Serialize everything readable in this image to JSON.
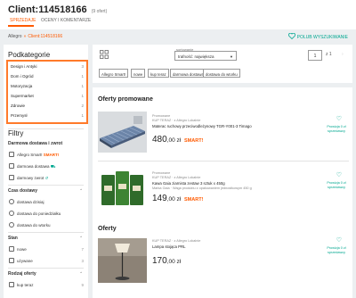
{
  "header": {
    "title": "Client:114518166",
    "offer_count": "(9 ofert)",
    "tabs": [
      "SPRZEDAJE",
      "OCENY I KOMENTARZE"
    ]
  },
  "breadcrumb": {
    "root": "Allegro",
    "separator": "»",
    "current": "Client:114518166"
  },
  "follow": {
    "label": "POLUB WYSZUKIWANIE"
  },
  "sidebar": {
    "subcategories_title": "Podkategorie",
    "categories": [
      {
        "label": "Design i Antyki",
        "count": "3"
      },
      {
        "label": "Dom i Ogród",
        "count": "1"
      },
      {
        "label": "Motoryzacja",
        "count": "1"
      },
      {
        "label": "Supermarket",
        "count": "1"
      },
      {
        "label": "Zdrowie",
        "count": "2"
      },
      {
        "label": "Przemysł",
        "count": "1"
      }
    ],
    "filters_title": "Filtry",
    "delivery": {
      "title": "Darmowa dostawa i zwrot",
      "options": [
        {
          "label": "Allegro Smart!",
          "badge": "SMART!"
        },
        {
          "label": "darmowa dostawa"
        },
        {
          "label": "darmowy zwrot"
        }
      ]
    },
    "time": {
      "title": "Czas dostawy",
      "options": [
        "dostawa dzisiaj",
        "dostawa do poniedziałku",
        "dostawa do wtorku"
      ]
    },
    "condition": {
      "title": "Stan",
      "options": [
        {
          "label": "nowe",
          "count": "7"
        },
        {
          "label": "używane",
          "count": "3"
        }
      ]
    },
    "offer_type": {
      "title": "Rodzaj oferty",
      "options": [
        {
          "label": "kup teraz",
          "count": "9"
        }
      ]
    }
  },
  "toolbar": {
    "sort_label": "sortowanie",
    "sort_value": "trafność: największa",
    "page": "1",
    "page_of": "z 1",
    "page_next": "›",
    "chips": [
      "Allegro Smart!",
      "nowe",
      "kup teraz",
      "darmowa dostawa",
      "dostawa do wtorku"
    ]
  },
  "promoted": {
    "title": "Oferty promowane",
    "items": [
      {
        "promoted_label": "Promowane",
        "seller": "KUP TERAZ  ·  z Allegro Lokalnie",
        "name": "Materac ruchowy przeciwodleżynowy TGR-Y001-3 Timago",
        "price_int": "480",
        "price_dec": ",00 zł",
        "smart": "SMART!",
        "zero_label": "Prowizja 0 zł sprzedawcy"
      },
      {
        "promoted_label": "Promowane",
        "seller": "KUP TERAZ  ·  z Allegro Lokalnie",
        "name": "Kawa Gaia ziarnista zestaw 3 sztuk x 450g",
        "detail": "Marka Gaia  ·  Waga produktu z opakowaniem jednostkowym 450 g",
        "price_int": "149",
        "price_dec": ",00 zł",
        "smart": "SMART!",
        "zero_label": "Prowizja 0 zł sprzedawcy"
      }
    ]
  },
  "offers": {
    "title": "Oferty",
    "items": [
      {
        "seller": "KUP TERAZ  ·  z Allegro Lokalnie",
        "name": "Lampa stojąca PRL",
        "price_int": "170",
        "price_dec": ",00 zł",
        "zero_label": "Prowizja 0 zł sprzedawcy"
      }
    ]
  },
  "colors": {
    "accent": "#ff5a00",
    "follow": "#00a790",
    "highlight_border": "#ff7a2a",
    "background": "#eceff1"
  },
  "icons": [
    "heart-icon",
    "grid-view-icon",
    "chevron-down-icon",
    "truck-icon",
    "return-icon"
  ]
}
